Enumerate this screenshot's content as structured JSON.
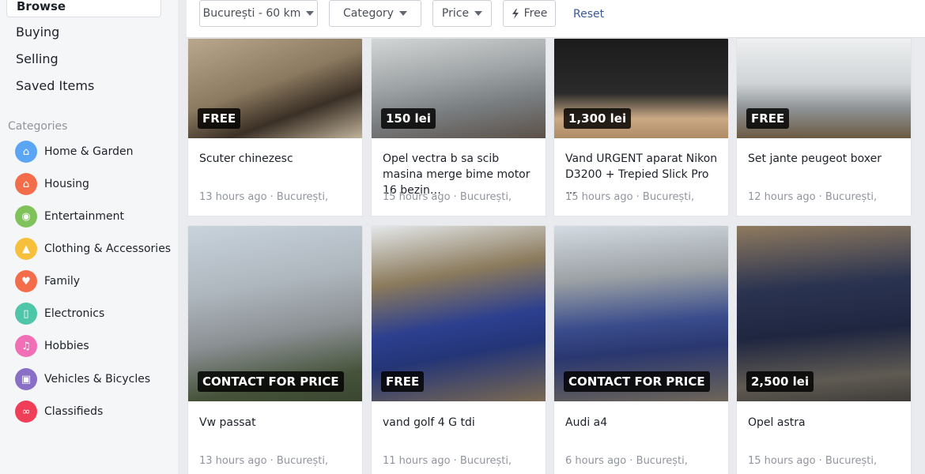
{
  "sidebar": {
    "browse_label": "Browse",
    "links": [
      "Buying",
      "Selling",
      "Saved Items"
    ],
    "categories_heading": "Categories",
    "categories": [
      {
        "label": "Home & Garden",
        "icon": "house-icon",
        "color": "#5aa6f5"
      },
      {
        "label": "Housing",
        "icon": "home-icon",
        "color": "#f36d4a"
      },
      {
        "label": "Entertainment",
        "icon": "gamepad-icon",
        "color": "#7fc25a"
      },
      {
        "label": "Clothing & Accessories",
        "icon": "shirt-icon",
        "color": "#f7c03c"
      },
      {
        "label": "Family",
        "icon": "heart-icon",
        "color": "#f36d4a"
      },
      {
        "label": "Electronics",
        "icon": "phone-icon",
        "color": "#4fc6a8"
      },
      {
        "label": "Hobbies",
        "icon": "guitar-icon",
        "color": "#f06fb5"
      },
      {
        "label": "Vehicles & Bicycles",
        "icon": "car-icon",
        "color": "#8a6fc7"
      },
      {
        "label": "Classifieds",
        "icon": "binoculars-icon",
        "color": "#f03e58"
      }
    ]
  },
  "filters": {
    "location": "București - 60 km",
    "category": "Category",
    "price": "Price",
    "free": "Free",
    "reset": "Reset"
  },
  "listings": [
    {
      "title": "Scuter chinezesc",
      "price": "FREE",
      "meta": "13 hours ago · București,"
    },
    {
      "title": "Opel vectra b sa scib masina merge bime motor 16 bezin…",
      "price": "150 lei",
      "meta": "15 hours ago · București,"
    },
    {
      "title": "Vand URGENT aparat Nikon D3200 + Trepied Slick Pro …",
      "price": "1,300 lei",
      "meta": "15 hours ago · București,"
    },
    {
      "title": "Set jante peugeot boxer",
      "price": "FREE",
      "meta": "12 hours ago · București,"
    },
    {
      "title": "Vw passat",
      "price": "CONTACT FOR PRICE",
      "meta": "13 hours ago · București,"
    },
    {
      "title": "vand golf 4 G tdi",
      "price": "FREE",
      "meta": "11 hours ago · București,"
    },
    {
      "title": "Audi a4",
      "price": "CONTACT FOR PRICE",
      "meta": "6 hours ago · București,"
    },
    {
      "title": "Opel astra",
      "price": "2,500 lei",
      "meta": "15 hours ago · București,"
    }
  ]
}
